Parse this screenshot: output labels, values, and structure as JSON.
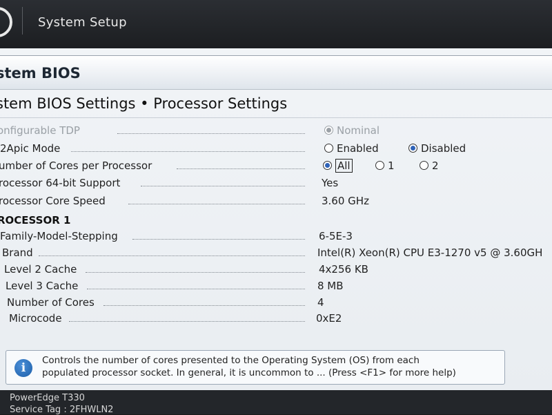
{
  "header": {
    "title": "System Setup"
  },
  "page": {
    "section_title": "stem BIOS",
    "breadcrumb": "stem BIOS Settings • Processor Settings"
  },
  "settings": [
    {
      "label": "onfigurable TDP",
      "options": [
        {
          "label": "Nominal",
          "selected": true
        }
      ],
      "disabled": true
    },
    {
      "label": "2Apic Mode",
      "options": [
        {
          "label": "Enabled",
          "selected": false
        },
        {
          "label": "Disabled",
          "selected": true
        }
      ]
    },
    {
      "label": "umber of Cores per Processor",
      "options": [
        {
          "label": "All",
          "selected": true
        },
        {
          "label": "1",
          "selected": false
        },
        {
          "label": "2",
          "selected": false
        }
      ]
    },
    {
      "label": "rocessor 64-bit Support",
      "value": "Yes"
    },
    {
      "label": "rocessor Core Speed",
      "value": "3.60 GHz"
    }
  ],
  "processor1": {
    "heading": "ROCESSOR 1",
    "rows": [
      {
        "label": "Family-Model-Stepping",
        "value": "6-5E-3"
      },
      {
        "label": "Brand",
        "value": "Intel(R) Xeon(R) CPU E3-1270 v5 @ 3.60GH"
      },
      {
        "label": "Level 2 Cache",
        "value": "4x256 KB"
      },
      {
        "label": "Level 3 Cache",
        "value": "8 MB"
      },
      {
        "label": "Number of Cores",
        "value": "4"
      },
      {
        "label": "Microcode",
        "value": "0xE2"
      }
    ]
  },
  "help": {
    "icon": "info-icon",
    "line1": "Controls the number of cores presented to the Operating System (OS) from each",
    "line2": "populated processor socket. In general, it is uncommon to ... (Press <F1> for more help)"
  },
  "footer": {
    "model": "PowerEdge T330",
    "service_tag": "Service Tag : 2FHWLN2"
  },
  "colors": {
    "accent": "#2f63b8",
    "header_bg": "#1c1e21"
  }
}
